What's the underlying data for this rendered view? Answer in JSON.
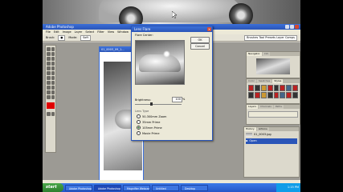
{
  "app": {
    "title": "Adobe Photoshop",
    "menus": [
      "File",
      "Edit",
      "Image",
      "Layer",
      "Select",
      "Filter",
      "View",
      "Window",
      "Help"
    ],
    "options": {
      "brush_label": "Brush:",
      "mode_label": "Mode:",
      "mode_value": "Soft"
    },
    "right_field": "Brushes  Tool Presets  Layer Comps"
  },
  "document": {
    "title": "01_0003_09_1..."
  },
  "dialog": {
    "title": "Lens Flare",
    "ok_label": "OK",
    "cancel_label": "Cancel",
    "center_label": "Flare Center:",
    "brightness_label": "Brightness:",
    "brightness_value": "100",
    "brightness_unit": "%",
    "brightness_fraction": 0.35,
    "lens_type_label": "Lens Type",
    "lens_options": [
      {
        "label": "50-300mm Zoom",
        "selected": false
      },
      {
        "label": "35mm Prime",
        "selected": false
      },
      {
        "label": "105mm Prime",
        "selected": true
      },
      {
        "label": "Movie Prime",
        "selected": false
      }
    ]
  },
  "panels": {
    "navigator_tabs": [
      "Navigator",
      "Info"
    ],
    "color_tabs": [
      "Color",
      "Swatches",
      "Styles"
    ],
    "layers_tabs": [
      "Layers",
      "Channels",
      "Paths"
    ],
    "history_tabs": [
      "History",
      "Actions"
    ],
    "history_items": [
      "01_0003.jpg",
      "Open"
    ]
  },
  "taskbar": {
    "start_label": "start",
    "tasks": [
      "Adobe Photoshop CS2",
      "Adobe Photoshop",
      "Magnifier Webcam",
      "Untitled",
      "Desktop"
    ],
    "clock": "1:15 PM"
  },
  "colors": {
    "accent": "#2a55b8",
    "foreground": "#e00000",
    "taskbar": "#2456c8"
  }
}
